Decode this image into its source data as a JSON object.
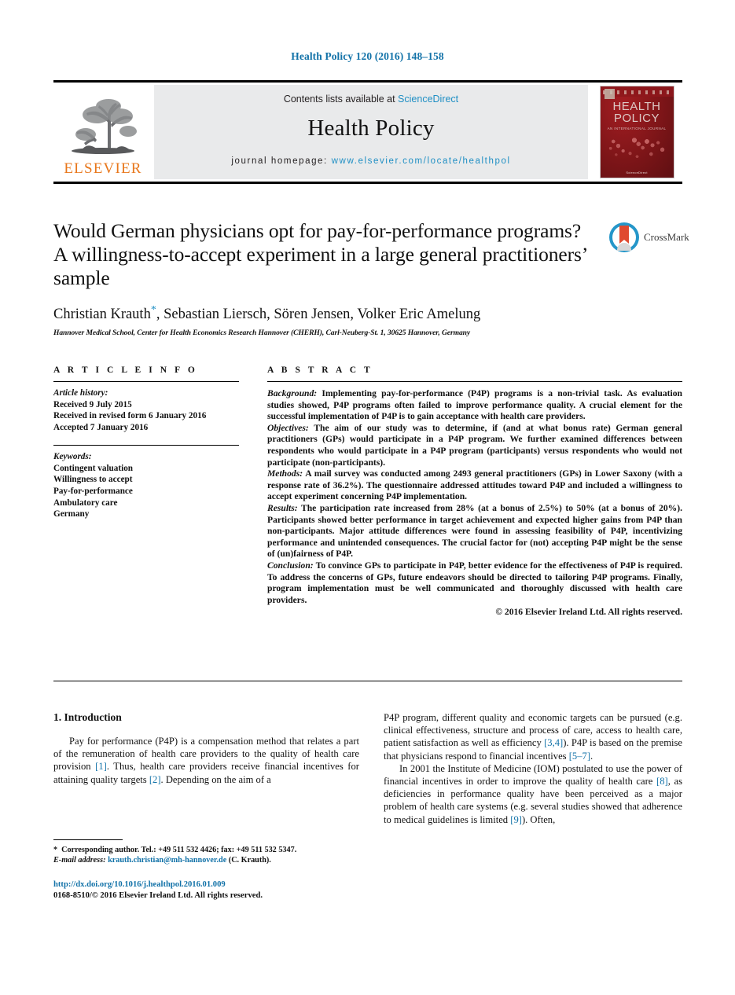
{
  "running_head": "Health Policy 120 (2016) 148–158",
  "masthead": {
    "publisher_name": "ELSEVIER",
    "contents_prefix": "Contents lists available at ",
    "contents_link": "ScienceDirect",
    "journal_name": "Health Policy",
    "homepage_prefix": "journal homepage: ",
    "homepage_url": "www.elsevier.com/locate/healthpol",
    "cover": {
      "line1": "HEALTH",
      "line2": "POLICY",
      "subtitle": "AN INTERNATIONAL JOURNAL",
      "footer": "ScienceDirect"
    }
  },
  "article": {
    "title": "Would German physicians opt for pay-for-performance programs? A willingness-to-accept experiment in a large general practitioners’ sample",
    "authors": "Christian Krauth",
    "authors_rest": ", Sebastian Liersch, Sören Jensen, Volker Eric Amelung",
    "corresponding_marker": "*",
    "affiliation": "Hannover Medical School, Center for Health Economics Research Hannover (CHERH), Carl-Neuberg-St. 1, 30625 Hannover, Germany",
    "crossmark_label": "CrossMark"
  },
  "article_info": {
    "heading": "A R T I C L E    I N F O",
    "history_label": "Article history:",
    "history": [
      "Received 9 July 2015",
      "Received in revised form 6 January 2016",
      "Accepted 7 January 2016"
    ],
    "keywords_label": "Keywords:",
    "keywords": [
      "Contingent valuation",
      "Willingness to accept",
      "Pay-for-performance",
      "Ambulatory care",
      "Germany"
    ]
  },
  "abstract": {
    "heading": "A B S T R A C T",
    "sections": [
      {
        "label": "Background:",
        "text": " Implementing pay-for-performance (P4P) programs is a non-trivial task. As evaluation studies showed, P4P programs often failed to improve performance quality. A crucial element for the successful implementation of P4P is to gain acceptance with health care providers."
      },
      {
        "label": "Objectives:",
        "text": " The aim of our study was to determine, if (and at what bonus rate) German general practitioners (GPs) would participate in a P4P program. We further examined differences between respondents who would participate in a P4P program (participants) versus respondents who would not participate (non-participants)."
      },
      {
        "label": "Methods:",
        "text": " A mail survey was conducted among 2493 general practitioners (GPs) in Lower Saxony (with a response rate of 36.2%). The questionnaire addressed attitudes toward P4P and included a willingness to accept experiment concerning P4P implementation."
      },
      {
        "label": "Results:",
        "text": " The participation rate increased from 28% (at a bonus of 2.5%) to 50% (at a bonus of 20%). Participants showed better performance in target achievement and expected higher gains from P4P than non-participants. Major attitude differences were found in assessing feasibility of P4P, incentivizing performance and unintended consequences. The crucial factor for (not) accepting P4P might be the sense of (un)fairness of P4P."
      },
      {
        "label": "Conclusion:",
        "text": " To convince GPs to participate in P4P, better evidence for the effectiveness of P4P is required. To address the concerns of GPs, future endeavors should be directed to tailoring P4P programs. Finally, program implementation must be well communicated and thoroughly discussed with health care providers."
      }
    ],
    "copyright": "© 2016 Elsevier Ireland Ltd. All rights reserved."
  },
  "body": {
    "section_heading": "1. Introduction",
    "left_paragraphs": [
      {
        "parts": [
          {
            "t": "Pay for performance (P4P) is a compensation method that relates a part of the remuneration of health care providers to the quality of health care provision "
          },
          {
            "t": "[1]",
            "ref": true
          },
          {
            "t": ". Thus, health care providers receive financial incentives for attaining quality targets "
          },
          {
            "t": "[2]",
            "ref": true
          },
          {
            "t": ". Depending on the aim of a"
          }
        ]
      }
    ],
    "right_paragraphs": [
      {
        "indent": false,
        "parts": [
          {
            "t": "P4P program, different quality and economic targets can be pursued (e.g. clinical effectiveness, structure and process of care, access to health care, patient satisfaction as well as efficiency "
          },
          {
            "t": "[3,4]",
            "ref": true
          },
          {
            "t": "). P4P is based on the premise that physicians respond to financial incentives "
          },
          {
            "t": "[5–7]",
            "ref": true
          },
          {
            "t": "."
          }
        ]
      },
      {
        "indent": true,
        "parts": [
          {
            "t": "In 2001 the Institute of Medicine (IOM) postulated to use the power of financial incentives in order to improve the quality of health care "
          },
          {
            "t": "[8]",
            "ref": true
          },
          {
            "t": ", as deficiencies in performance quality have been perceived as a major problem of health care systems (e.g. several studies showed that adherence to medical guidelines is limited "
          },
          {
            "t": "[9]",
            "ref": true
          },
          {
            "t": "). Often,"
          }
        ]
      }
    ]
  },
  "footer": {
    "corresponding_star": "*",
    "corresponding_text": "Corresponding author. Tel.: +49 511 532 4426; fax: +49 511 532 5347.",
    "email_label": "E-mail address:",
    "email": "krauth.christian@mh-hannover.de",
    "email_owner": "(C. Krauth).",
    "doi_url": "http://dx.doi.org/10.1016/j.healthpol.2016.01.009",
    "issn_line": "0168-8510/© 2016 Elsevier Ireland Ltd. All rights reserved."
  },
  "colors": {
    "link": "#1272a8",
    "elsevier_orange": "#e8761a",
    "sciencedirect_blue": "#1f8fc4",
    "masthead_gray": "#e9eaeb",
    "cover_red": "#8e181c"
  }
}
